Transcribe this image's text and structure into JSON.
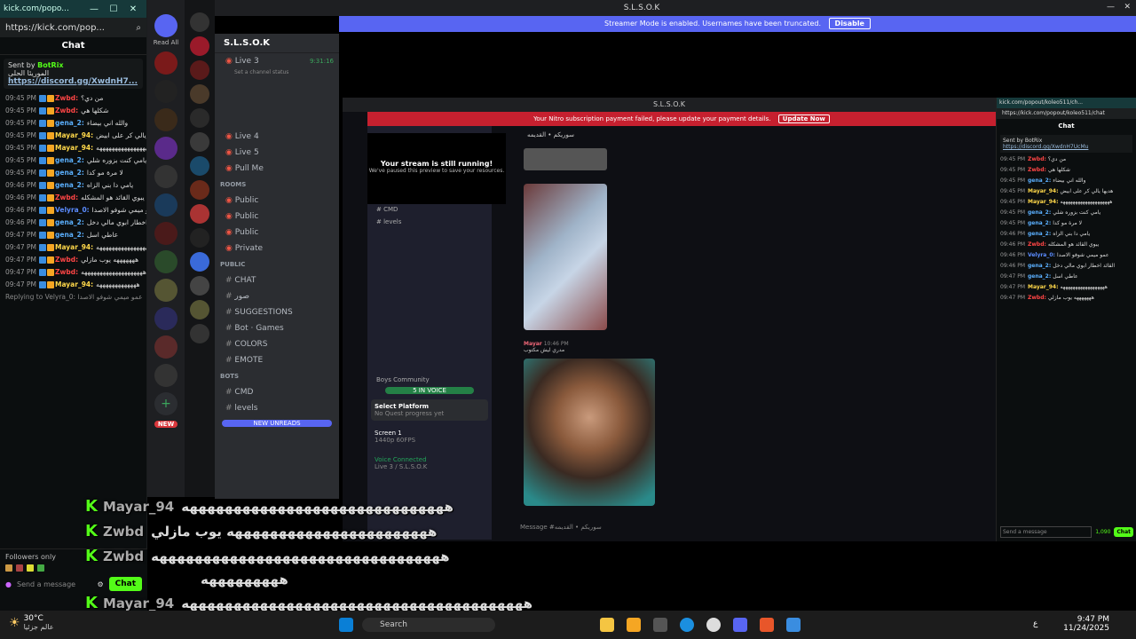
{
  "kick_window": {
    "title": "kick.com/popo...",
    "url": "https://kick.com/pop...",
    "chat_title": "Chat",
    "pinned_by": "Sent by",
    "pinned_user": "BotRix",
    "pinned_text": "الموريئا الحلى",
    "pinned_link": "https://discord.gg/XwdnH7...",
    "followers_only": "Followers only",
    "send_placeholder": "Send a message",
    "chat_button": "Chat"
  },
  "kick_messages": [
    {
      "time": "09:45 PM",
      "user": "Zwbd:",
      "text": "من دي؟",
      "color": "#ff4545"
    },
    {
      "time": "09:45 PM",
      "user": "Zwbd:",
      "text": "شكلها هي",
      "color": "#ff4545"
    },
    {
      "time": "09:45 PM",
      "user": "gena_2:",
      "text": "والله اني بيضاء",
      "color": "#5bb0ff"
    },
    {
      "time": "09:45 PM",
      "user": "Mayar_94:",
      "text": "هديها يالي كر على ابيض",
      "color": "#ffd84a"
    },
    {
      "time": "09:45 PM",
      "user": "Mayar_94:",
      "text": "ههههههههههههههههههههه",
      "color": "#ffd84a"
    },
    {
      "time": "09:45 PM",
      "user": "gena_2:",
      "text": "يامي كنت بزوره شلي",
      "color": "#5bb0ff"
    },
    {
      "time": "09:45 PM",
      "user": "gena_2:",
      "text": "لا مرة مو كدا",
      "color": "#5bb0ff"
    },
    {
      "time": "09:46 PM",
      "user": "gena_2:",
      "text": "يامي دا بني الزاه",
      "color": "#5bb0ff"
    },
    {
      "time": "09:46 PM",
      "user": "Zwbd:",
      "text": "يبوي القائد هو المشكله",
      "color": "#ff4545"
    },
    {
      "time": "09:46 PM",
      "user": "Velyra_0:",
      "text": "عمو ميمي شوفو الاصدا",
      "color": "#5b8cff"
    },
    {
      "time": "09:46 PM",
      "user": "gena_2:",
      "text": "القائد اخطار ابوي مالي دخل",
      "color": "#5bb0ff"
    },
    {
      "time": "09:47 PM",
      "user": "gena_2:",
      "text": "عاطي اسل",
      "color": "#5bb0ff"
    },
    {
      "time": "09:47 PM",
      "user": "Mayar_94:",
      "text": "ههههههههههههههههههه",
      "color": "#ffd84a"
    },
    {
      "time": "09:47 PM",
      "user": "Zwbd:",
      "text": "هههههههه يوب مازلي",
      "color": "#ff4545"
    },
    {
      "time": "09:47 PM",
      "user": "Zwbd:",
      "text": "ههههههههههههههههههههه",
      "color": "#ff4545"
    },
    {
      "time": "09:47 PM",
      "user": "Mayar_94:",
      "text": "هههههههههههههه",
      "color": "#ffd84a"
    }
  ],
  "reply_note": "Replying to Velyra_0: عمو ميمي شوفو الاصدا",
  "discord": {
    "top_title": "S.L.S.O.K",
    "banner": "Streamer Mode is enabled. Usernames have been truncated.",
    "banner_btn": "Disable",
    "server_name": "S.L.S.O.K",
    "read_all": "Read All",
    "new_label": "NEW",
    "new_unreads": "NEW UNREADS",
    "set_status": "Set a channel status"
  },
  "channels": [
    {
      "type": "voice",
      "name": "Live 3",
      "live": "9:31:16"
    },
    {
      "type": "voice",
      "name": "Live 4"
    },
    {
      "type": "voice",
      "name": "Live 5"
    },
    {
      "type": "voice",
      "name": "Pull Me"
    },
    {
      "type": "cat",
      "name": "ROOMS"
    },
    {
      "type": "voice",
      "name": "Public"
    },
    {
      "type": "voice",
      "name": "Public"
    },
    {
      "type": "voice",
      "name": "Public"
    },
    {
      "type": "voice",
      "name": "Private"
    },
    {
      "type": "cat",
      "name": "PUBLIC"
    },
    {
      "type": "text",
      "name": "CHAT"
    },
    {
      "type": "text",
      "name": "صور"
    },
    {
      "type": "text",
      "name": "SUGGESTIONS"
    },
    {
      "type": "text",
      "name": "Bot · Games"
    },
    {
      "type": "text",
      "name": "COLORS"
    },
    {
      "type": "text",
      "name": "EMOTE"
    },
    {
      "type": "cat",
      "name": "BOTS"
    },
    {
      "type": "text",
      "name": "CMD"
    },
    {
      "type": "text",
      "name": "levels"
    }
  ],
  "inner": {
    "title": "S.L.S.O.K",
    "banner": "Your Nitro subscription payment failed, please update your payment details.",
    "banner_btn": "Update Now",
    "stream_title": "Your stream is still running!",
    "stream_sub": "We've paused this preview to save your resources.",
    "channel_header": "سوريكم • القديمه",
    "select_platform": "Select Platform",
    "no_quest": "No Quest progress yet",
    "screen": "Screen 1",
    "screen_sub": "1440p 60FPS",
    "voice_connected": "Voice Connected",
    "voice_sub": "Live 3 / S.L.S.O.K",
    "msg_placeholder": "Message #سوريكم • القديمه",
    "msg_user": "Mayar",
    "msg_time": "10:46 PM",
    "msg_text": "مدري ليش مكتوب",
    "bots_cmd": "CMD",
    "bots_levels": "levels",
    "boys": "Boys Community",
    "in_voice": "5 IN VOICE"
  },
  "kick2": {
    "title": "kick.com/popout/koleo511/ch...",
    "url": "https://kick.com/popout/koleo511/chat",
    "chat": "Chat",
    "pinned": "Sent by BotRix",
    "link": "https://discord.gg/XwdnH7UcMu",
    "points": "1,090",
    "send": "Send a message",
    "chat_btn": "Chat"
  },
  "overlay": [
    {
      "user": "Mayar_94",
      "text": "ههههههههههههههههههههههههههههههه"
    },
    {
      "user": "Zwbd",
      "text": "هههههههههههههههههههههههه يوب مازلي"
    },
    {
      "user": "Zwbd",
      "text": "هههههههههههههههههههههههههههههههههه"
    },
    {
      "user": "",
      "text": "هههههههههه"
    },
    {
      "user": "Mayar_94",
      "text": "هههههههههههههههههههههههههههههههههههههههه"
    }
  ],
  "taskbar": {
    "temp": "30°C",
    "weather": "عالم جزئيا",
    "search": "Search",
    "time": "9:47 PM",
    "date": "11/24/2025",
    "lang": "ع"
  }
}
